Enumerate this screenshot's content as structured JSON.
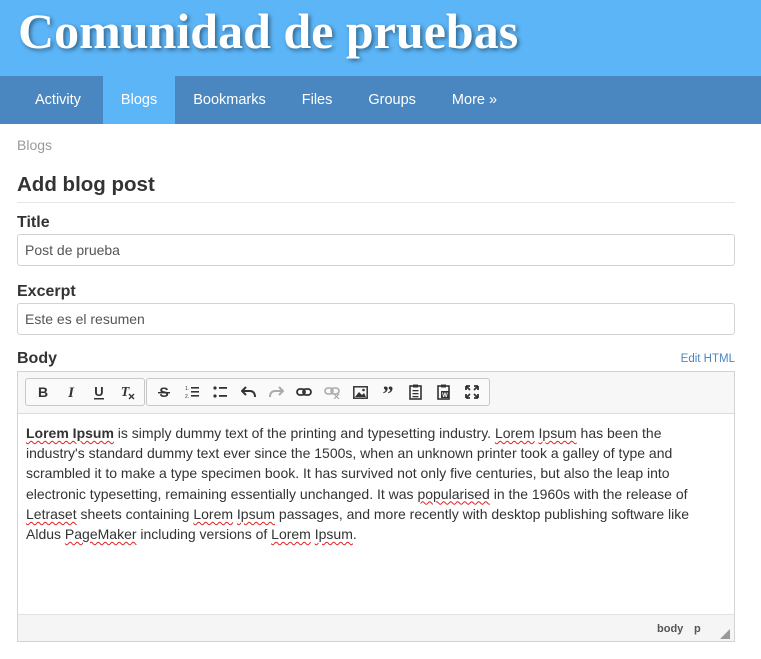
{
  "site": {
    "title": "Comunidad de pruebas"
  },
  "nav": {
    "items": [
      "Activity",
      "Blogs",
      "Bookmarks",
      "Files",
      "Groups",
      "More »"
    ],
    "active": "Blogs"
  },
  "breadcrumb": "Blogs",
  "page_title": "Add blog post",
  "form": {
    "title": {
      "label": "Title",
      "value": "Post de prueba"
    },
    "excerpt": {
      "label": "Excerpt",
      "value": "Este es el resumen"
    },
    "body": {
      "label": "Body",
      "edit_html": "Edit HTML",
      "toolbar_icons": [
        "bold-icon",
        "italic-icon",
        "underline-icon",
        "remove-format-icon",
        "strikethrough-icon",
        "numbered-list-icon",
        "bulleted-list-icon",
        "undo-icon",
        "redo-icon",
        "link-icon",
        "unlink-icon",
        "image-icon",
        "blockquote-icon",
        "paste-icon",
        "paste-from-word-icon",
        "maximize-icon"
      ],
      "content": {
        "s0": "Lorem Ipsum",
        "s1": " is simply dummy text of the printing and typesetting industry. ",
        "s2": "Lorem",
        "s3": " ",
        "s4": "Ipsum",
        "s5": " has been the industry's standard dummy text ever since the 1500s, when an unknown printer took a galley of type and scrambled it to make a type specimen book. It has survived not only five centuries, but also the leap into electronic typesetting, remaining essentially unchanged. It was ",
        "s6": "popularised",
        "s7": " in the 1960s with the release of ",
        "s8": "Letraset",
        "s9": " sheets containing ",
        "s10": "Lorem",
        "s11": " ",
        "s12": "Ipsum",
        "s13": " passages, and more recently with desktop publishing software like Aldus ",
        "s14": "PageMaker",
        "s15": " including versions of ",
        "s16": "Lorem",
        "s17": " ",
        "s18": "Ipsum",
        "s19": "."
      },
      "status_path": [
        "body",
        "p"
      ]
    }
  },
  "colors": {
    "header_bg": "#5cb5f7",
    "nav_bg": "#4a87c0",
    "nav_active": "#5cb5f7",
    "link": "#4a87c0",
    "spellcheck": "#e02020"
  }
}
